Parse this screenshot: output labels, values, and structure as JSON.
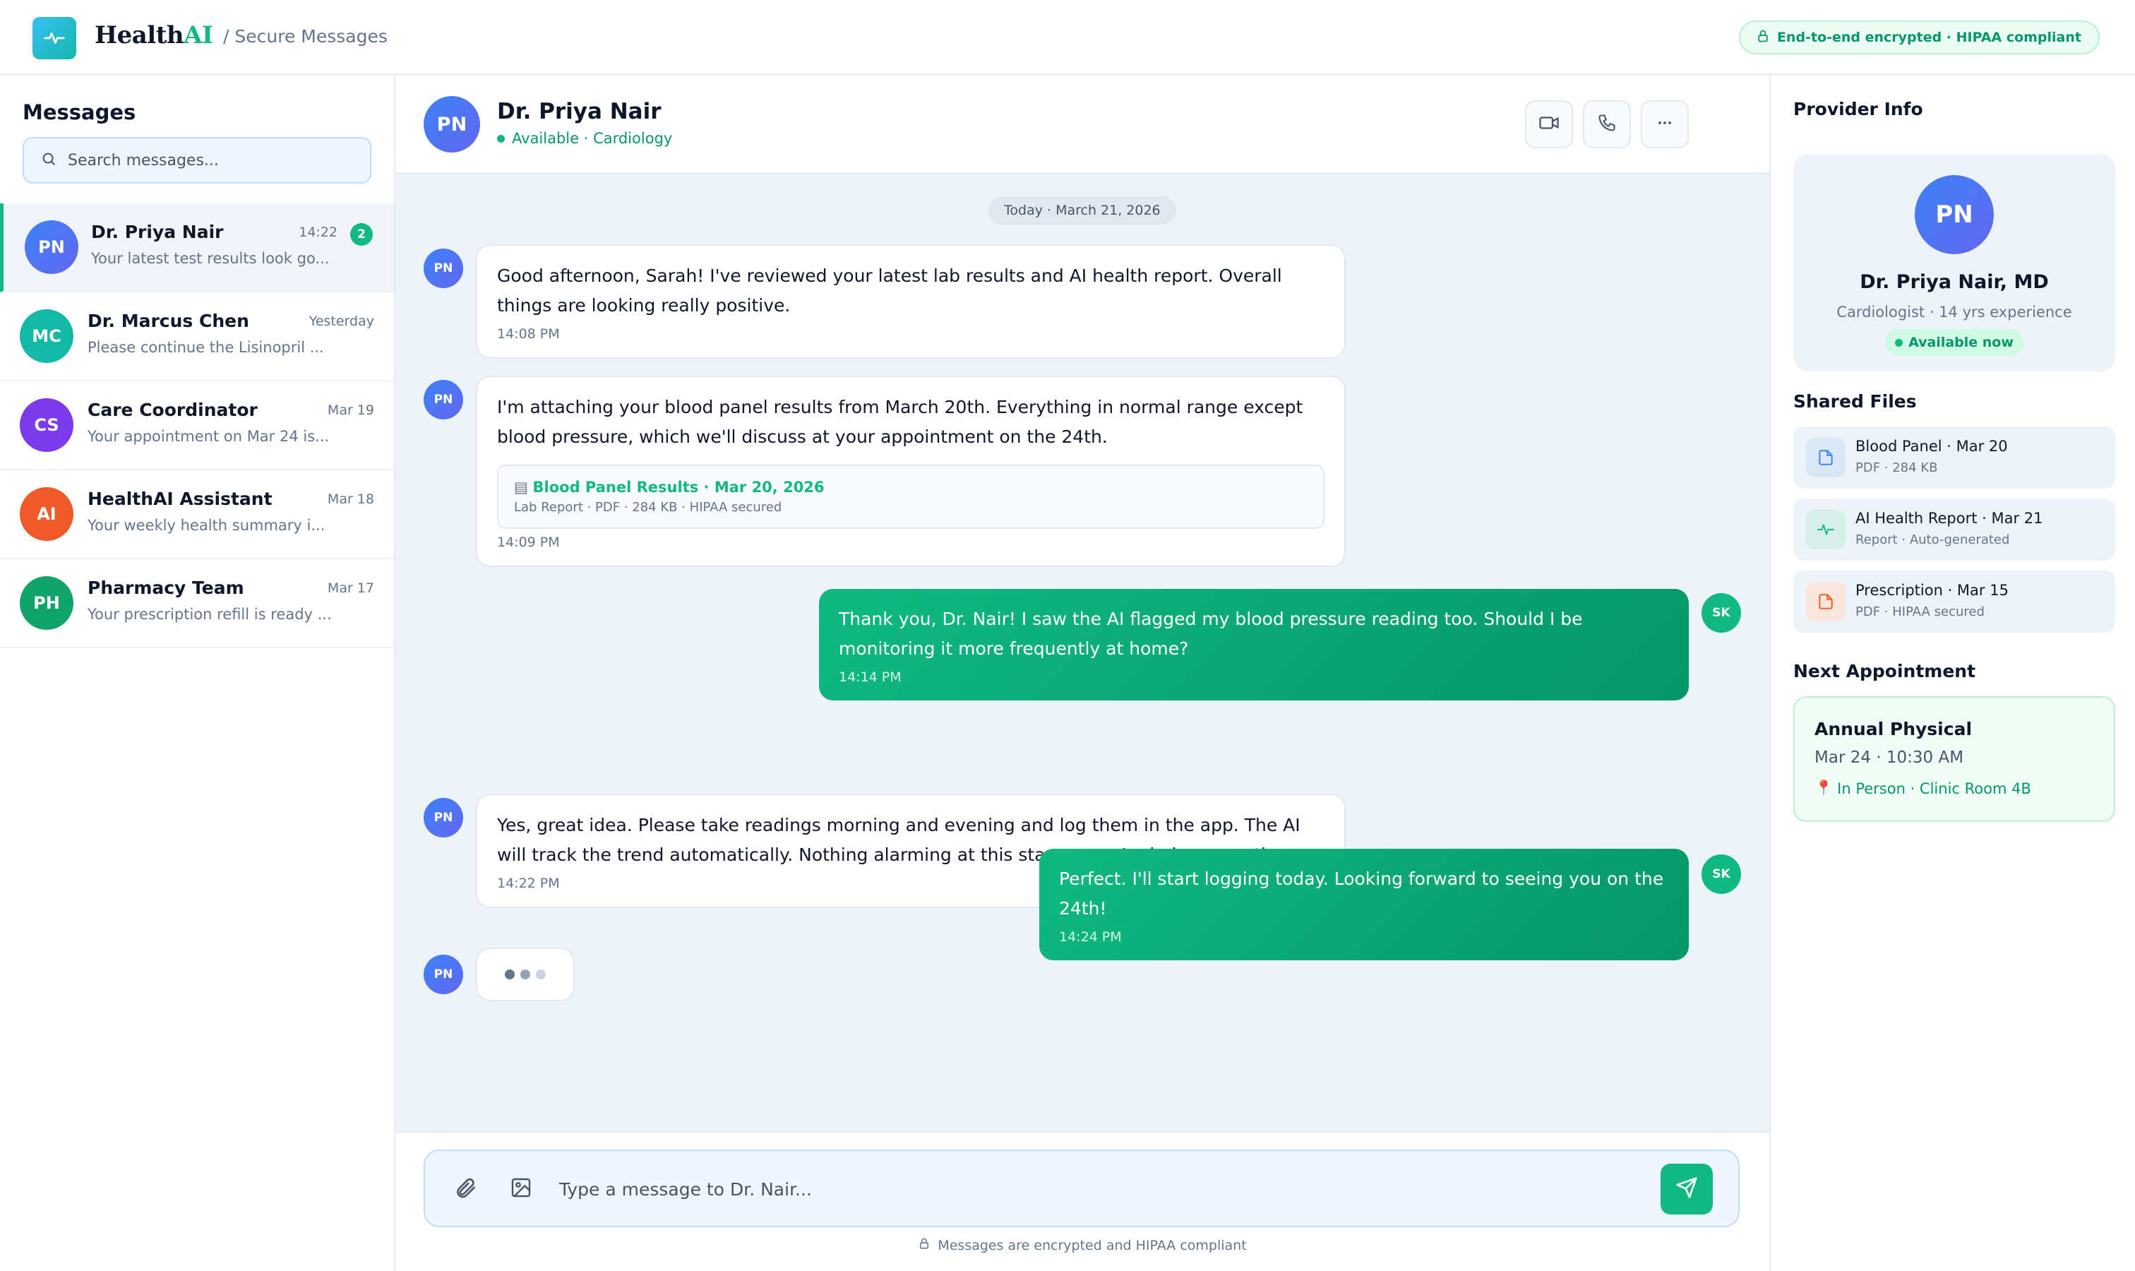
{
  "header": {
    "brand_main": "Health",
    "brand_accent": "AI",
    "breadcrumb": "/ Secure Messages",
    "encryption_badge": "End-to-end encrypted · HIPAA compliant"
  },
  "sidebar": {
    "title": "Messages",
    "search_placeholder": "Search messages...",
    "conversations": [
      {
        "initials": "PN",
        "name": "Dr. Priya Nair",
        "time": "14:22",
        "preview": "Your latest test results look go...",
        "unread": "2",
        "color": "#4f7cf5",
        "active": true
      },
      {
        "initials": "MC",
        "name": "Dr. Marcus Chen",
        "time": "Yesterday",
        "preview": "Please continue the Lisinopril ...",
        "unread": "",
        "color": "#14b8a6",
        "active": false
      },
      {
        "initials": "CS",
        "name": "Care Coordinator",
        "time": "Mar 19",
        "preview": "Your appointment on Mar 24 is...",
        "unread": "",
        "color": "#7c3aed",
        "active": false
      },
      {
        "initials": "AI",
        "name": "HealthAI Assistant",
        "time": "Mar 18",
        "preview": "Your weekly health summary i...",
        "unread": "",
        "color": "#f05a28",
        "active": false
      },
      {
        "initials": "PH",
        "name": "Pharmacy Team",
        "time": "Mar 17",
        "preview": "Your prescription refill is ready ...",
        "unread": "",
        "color": "#10a36b",
        "active": false
      }
    ]
  },
  "chat": {
    "contact_initials": "PN",
    "contact_name": "Dr. Priya Nair",
    "contact_status": "Available · Cardiology",
    "date_divider": "Today · March 21, 2026",
    "messages": [
      {
        "from": "PN",
        "text": "Good afternoon, Sarah! I've reviewed your latest lab results and AI health report. Overall things are looking really positive.",
        "time": "14:08 PM"
      },
      {
        "from": "PN",
        "text": "I'm attaching your blood panel results from March 20th. Everything in normal range except blood pressure, which we'll discuss at your appointment on the 24th.",
        "time": "14:09 PM",
        "attachment_title": "Blood Panel Results · Mar 20, 2026",
        "attachment_meta": "Lab Report · PDF · 284 KB · HIPAA secured"
      },
      {
        "from": "SK",
        "text": "Thank you, Dr. Nair! I saw the AI flagged my blood pressure reading too. Should I be monitoring it more frequently at home?",
        "time": "14:14 PM"
      },
      {
        "from": "PN",
        "text": "Yes, great idea. Please take readings morning and evening and log them in the app. The AI will track the trend automatically. Nothing alarming at this stage — we're being proactive.",
        "time": "14:22 PM"
      },
      {
        "from": "SK",
        "text": "Perfect. I'll start logging today. Looking forward to seeing you on the 24th!",
        "time": "14:24 PM"
      }
    ],
    "typing_initials": "PN",
    "composer_placeholder": "Type a message to Dr. Nair...",
    "footer_note": "Messages are encrypted and HIPAA compliant"
  },
  "provider_panel": {
    "title": "Provider Info",
    "initials": "PN",
    "name": "Dr. Priya Nair, MD",
    "subtitle": "Cardiologist · 14 yrs experience",
    "availability": "Available now",
    "files_title": "Shared Files",
    "files": [
      {
        "name": "Blood Panel · Mar 20",
        "meta": "PDF · 284 KB",
        "icon": "file-icon"
      },
      {
        "name": "AI Health Report · Mar 21",
        "meta": "Report · Auto-generated",
        "icon": "pulse-icon"
      },
      {
        "name": "Prescription · Mar 15",
        "meta": "PDF · HIPAA secured",
        "icon": "file-icon"
      }
    ],
    "appointment_title": "Next Appointment",
    "appointment": {
      "name": "Annual Physical",
      "when": "Mar 24 · 10:30 AM",
      "where": "In Person · Clinic Room 4B"
    }
  },
  "colors": {
    "accent": "#10b981",
    "brand_blue": "#3b82f6",
    "chat_bg": "#eef3f9"
  }
}
